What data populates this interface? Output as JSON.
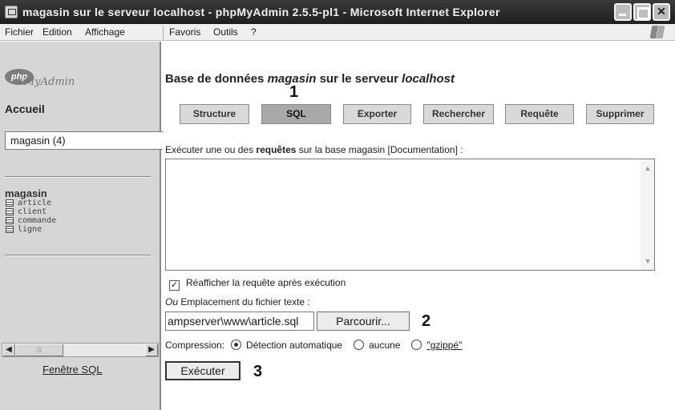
{
  "window": {
    "title": "magasin sur le serveur localhost - phpMyAdmin 2.5.5-pl1 - Microsoft Internet Explorer"
  },
  "menubar": {
    "items": [
      "Fichier",
      "Edition",
      "Affichage",
      "Favoris",
      "Outils",
      "?"
    ]
  },
  "sidebar": {
    "logo_badge": "php",
    "logo_text": "MyAdmin",
    "home_label": "Accueil",
    "db_select_value": "magasin (4)",
    "db_name": "magasin",
    "tables": [
      "article",
      "client",
      "commande",
      "ligne"
    ],
    "sql_window_link": "Fenêtre SQL"
  },
  "main": {
    "title_prefix": "Base de données",
    "title_db": "magasin",
    "title_mid": "sur le serveur",
    "title_server": "localhost",
    "tabs": [
      {
        "label": "Structure",
        "active": false
      },
      {
        "label": "SQL",
        "active": true
      },
      {
        "label": "Exporter",
        "active": false
      },
      {
        "label": "Rechercher",
        "active": false
      },
      {
        "label": "Requête",
        "active": false
      },
      {
        "label": "Supprimer",
        "active": false
      }
    ],
    "instructions_pre": "Exécuter une ou des",
    "instructions_bold": "requêtes",
    "instructions_post": "sur la base magasin [Documentation] :",
    "query_value": "",
    "redisplay_label": "Réafficher la requête après exécution",
    "redisplay_checked": true,
    "file_label_or": "Ou",
    "file_label": "Emplacement du fichier texte :",
    "file_value": "ampserver\\www\\article.sql",
    "browse_label": "Parcourir...",
    "compression_label": "Compression:",
    "compression_options": [
      "Détection automatique",
      "aucune",
      "\"gzippé\""
    ],
    "compression_selected": "Détection automatique",
    "execute_label": "Exécuter"
  },
  "callouts": [
    "1",
    "2",
    "3"
  ]
}
